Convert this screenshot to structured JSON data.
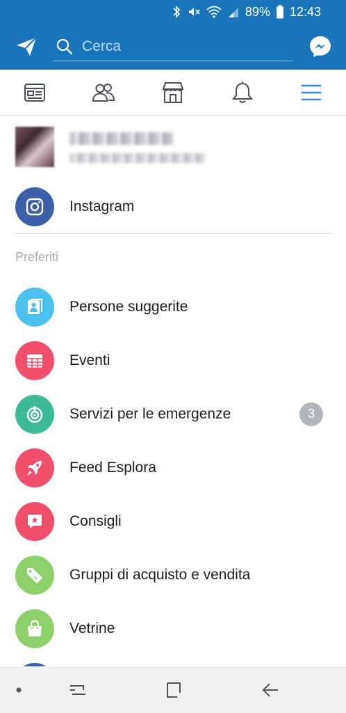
{
  "statusbar": {
    "battery": "89%",
    "time": "12:43"
  },
  "search": {
    "placeholder": "Cerca"
  },
  "shortcut": {
    "label": "Instagram"
  },
  "favorites": {
    "title": "Preferiti",
    "items": [
      {
        "label": "Persone suggerite",
        "color": "#4cc1f0",
        "icon": "people-card-icon"
      },
      {
        "label": "Eventi",
        "color": "#f0506e",
        "icon": "calendar-icon"
      },
      {
        "label": "Servizi per le emergenze",
        "color": "#3dbb99",
        "icon": "emergency-icon",
        "badge": "3"
      },
      {
        "label": "Feed Esplora",
        "color": "#f0506e",
        "icon": "rocket-icon"
      },
      {
        "label": "Consigli",
        "color": "#f0506e",
        "icon": "speech-star-icon"
      },
      {
        "label": "Gruppi di acquisto e vendita",
        "color": "#8ed06a",
        "icon": "tag-icon"
      },
      {
        "label": "Vetrine",
        "color": "#8ed06a",
        "icon": "shopping-bag-icon"
      }
    ]
  },
  "colors": {
    "brand": "#1a75b8",
    "instagram": "#3b5fa8",
    "badge": "#b2b5bc",
    "active_tab": "#3b82e6"
  }
}
